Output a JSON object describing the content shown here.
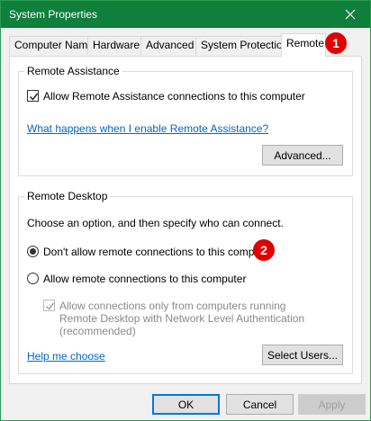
{
  "window": {
    "title": "System Properties",
    "title_bar_color": "#0f7f3c"
  },
  "tabs": [
    {
      "label": "Computer Name"
    },
    {
      "label": "Hardware"
    },
    {
      "label": "Advanced"
    },
    {
      "label": "System Protection"
    },
    {
      "label": "Remote",
      "active": true
    }
  ],
  "remote_assistance": {
    "group_title": "Remote Assistance",
    "allow_label": "Allow Remote Assistance connections to this computer",
    "allow_checked": true,
    "help_link": "What happens when I enable Remote Assistance?",
    "advanced_button": "Advanced..."
  },
  "remote_desktop": {
    "group_title": "Remote Desktop",
    "instruction": "Choose an option, and then specify who can connect.",
    "option_dont_allow": "Don't allow remote connections to this computer",
    "option_allow": "Allow remote connections to this computer",
    "selected_option": "dont_allow",
    "nla_label": "Allow connections only from computers running Remote Desktop with Network Level Authentication (recommended)",
    "nla_checked": true,
    "nla_enabled": false,
    "help_link": "Help me choose",
    "select_users_button": "Select Users..."
  },
  "footer": {
    "ok": "OK",
    "cancel": "Cancel",
    "apply": "Apply"
  },
  "annotations": {
    "badge1": "1",
    "badge2": "2",
    "badge_color": "#e00000"
  }
}
